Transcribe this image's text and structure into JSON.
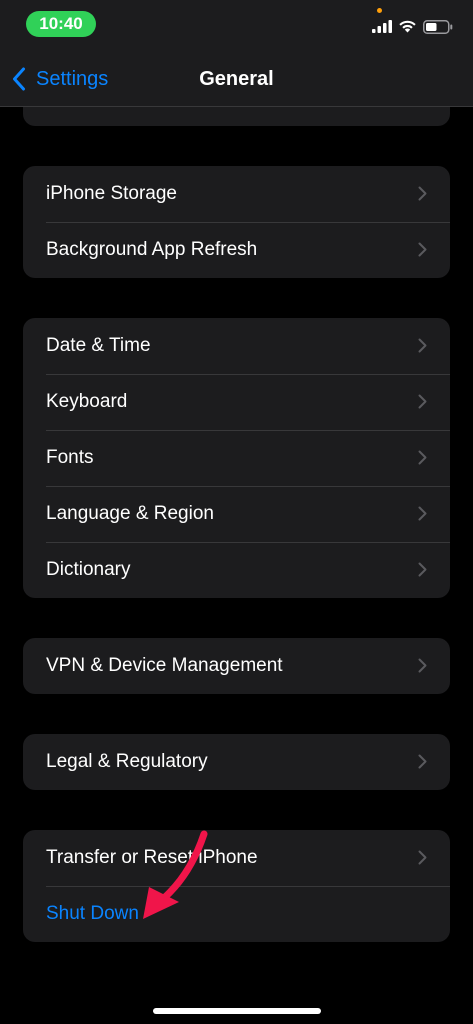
{
  "status_bar": {
    "time": "10:40",
    "icons": [
      "privacy-dot",
      "cellular-signal-icon",
      "wifi-icon",
      "battery-icon"
    ],
    "battery_level": 0.5
  },
  "nav": {
    "back_label": "Settings",
    "title": "General"
  },
  "groups": [
    {
      "rows": [
        {
          "label": "",
          "has_chevron": false
        }
      ]
    },
    {
      "rows": [
        {
          "label": "iPhone Storage",
          "has_chevron": true
        },
        {
          "label": "Background App Refresh",
          "has_chevron": true
        }
      ]
    },
    {
      "rows": [
        {
          "label": "Date & Time",
          "has_chevron": true
        },
        {
          "label": "Keyboard",
          "has_chevron": true
        },
        {
          "label": "Fonts",
          "has_chevron": true
        },
        {
          "label": "Language & Region",
          "has_chevron": true
        },
        {
          "label": "Dictionary",
          "has_chevron": true
        }
      ]
    },
    {
      "rows": [
        {
          "label": "VPN & Device Management",
          "has_chevron": true
        }
      ]
    },
    {
      "rows": [
        {
          "label": "Legal & Regulatory",
          "has_chevron": true
        }
      ]
    },
    {
      "rows": [
        {
          "label": "Transfer or Reset iPhone",
          "has_chevron": true
        },
        {
          "label": "Shut Down",
          "has_chevron": false,
          "style": "action"
        }
      ]
    }
  ],
  "colors": {
    "background": "#000000",
    "cell": "#1c1c1e",
    "separator": "#38383a",
    "accent": "#0a84ff",
    "time_pill": "#30d158",
    "annotation_arrow": "#f0154a"
  }
}
